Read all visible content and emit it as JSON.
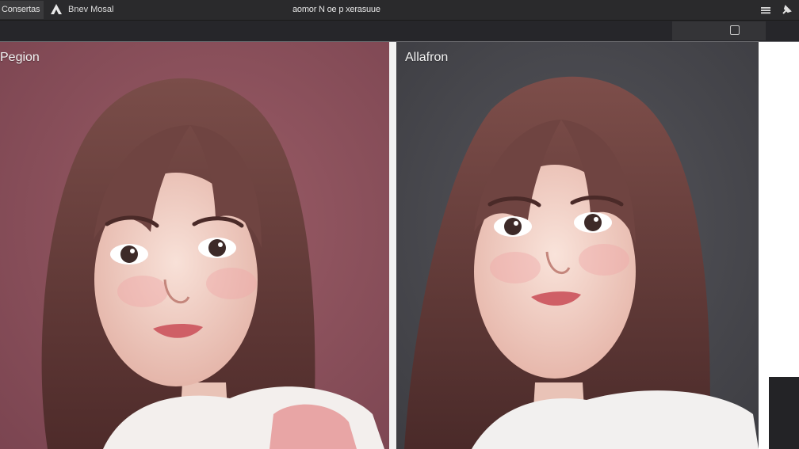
{
  "titlebar": {
    "tab_label": "Consertas",
    "logo_icon": "triangle-logo-icon",
    "app_name": "Bnev Mosal",
    "window_title": "aomor N oe p xerasuue",
    "menu_icon": "hamburger-menu-icon",
    "pin_icon": "pin-icon"
  },
  "toolbar": {
    "view_icon": "square-view-icon"
  },
  "panels": [
    {
      "label": "Pegion",
      "background": "#874f58",
      "image": "portrait-photo-left"
    },
    {
      "label": "Allafron",
      "background": "#46464b",
      "image": "portrait-photo-right"
    }
  ],
  "colors": {
    "titlebar": "#2a2a2c",
    "toolbar": "#26262a",
    "panel_left_bg": "#874f58",
    "panel_right_bg": "#46464b",
    "hair": "#6b3f3a",
    "skin": "#f1d2c8"
  }
}
